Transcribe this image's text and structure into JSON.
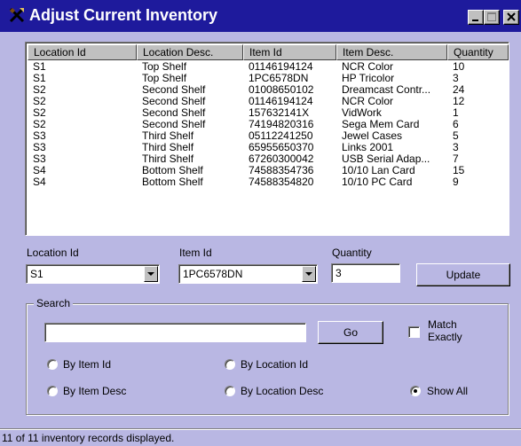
{
  "window": {
    "title": "Adjust Current Inventory",
    "icon": "tools-icon"
  },
  "table": {
    "columns": [
      "Location Id",
      "Location Desc.",
      "Item Id",
      "Item Desc.",
      "Quantity"
    ],
    "rows": [
      [
        "S1",
        "Top Shelf",
        "01146194124",
        "NCR Color",
        "10"
      ],
      [
        "S1",
        "Top Shelf",
        "1PC6578DN",
        "HP Tricolor",
        "3"
      ],
      [
        "S2",
        "Second Shelf",
        "01008650102",
        "Dreamcast Contr...",
        "24"
      ],
      [
        "S2",
        "Second Shelf",
        "01146194124",
        "NCR Color",
        "12"
      ],
      [
        "S2",
        "Second Shelf",
        "157632141X",
        "VidWork",
        "1"
      ],
      [
        "S2",
        "Second Shelf",
        "74194820316",
        "Sega Mem Card",
        "6"
      ],
      [
        "S3",
        "Third Shelf",
        "05112241250",
        "Jewel Cases",
        "5"
      ],
      [
        "S3",
        "Third Shelf",
        "65955650370",
        "Links 2001",
        "3"
      ],
      [
        "S3",
        "Third Shelf",
        "67260300042",
        "USB Serial Adap...",
        "7"
      ],
      [
        "S4",
        "Bottom Shelf",
        "74588354736",
        "10/10 Lan Card",
        "15"
      ],
      [
        "S4",
        "Bottom Shelf",
        "74588354820",
        "10/10 PC Card",
        "9"
      ]
    ]
  },
  "form": {
    "location_label": "Location Id",
    "location_value": "S1",
    "item_label": "Item Id",
    "item_value": "1PC6578DN",
    "quantity_label": "Quantity",
    "quantity_value": "3",
    "update_label": "Update"
  },
  "search": {
    "group_label": "Search",
    "input_value": "",
    "go_label": "Go",
    "match_exactly_label_1": "Match",
    "match_exactly_label_2": "Exactly",
    "match_exactly_checked": false,
    "options": {
      "by_item_id": "By Item Id",
      "by_location_id": "By Location Id",
      "by_item_desc": "By Item Desc",
      "by_location_desc": "By Location Desc",
      "show_all": "Show All"
    },
    "selected": "show_all"
  },
  "status": {
    "text": "11 of 11 inventory records displayed."
  },
  "colors": {
    "window_bg": "#b9b7e3",
    "titlebar": "#1e1a9c",
    "list_bg": "#ffffff"
  }
}
